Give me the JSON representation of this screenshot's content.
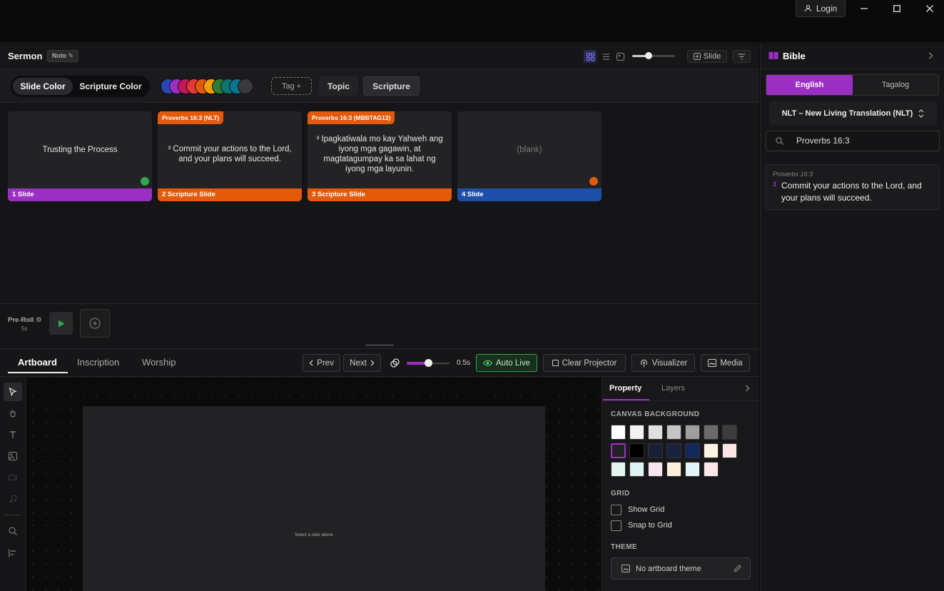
{
  "window": {
    "login_label": "Login"
  },
  "header": {
    "title": "Sermon",
    "note_badge": "Note ✎",
    "slide_button": "Slide"
  },
  "toolbar": {
    "slide_color": "Slide Color",
    "scripture_color": "Scripture Color",
    "tag_button": "Tag +",
    "topic_button": "Topic",
    "scripture_button": "Scripture",
    "swatches": [
      "#2946b8",
      "#9b2fc4",
      "#c2185b",
      "#e53935",
      "#e35a0b",
      "#f59e0b",
      "#2e7d32",
      "#0f766e",
      "#0e7490",
      "#3a3a3e"
    ]
  },
  "slides": [
    {
      "text": "Trusting the Process",
      "footer": "1 Slide",
      "footer_color": "#9b2fc4",
      "dot_color": "#2fa84f"
    },
    {
      "tag": "Proverbs 16:3 (NLT)",
      "text": "³ Commit your actions to the Lord, and your plans will succeed.",
      "footer": "2 Scripture Slide",
      "footer_color": "#e35a0b"
    },
    {
      "tag": "Proverbs 16:3 (MBBTAG12)",
      "text": "³ Ipagkatiwala mo kay Yahweh ang iyong mga gagawin, at magtatagumpay ka sa lahat ng iyong mga layunin.",
      "footer": "3 Scripture Slide",
      "footer_color": "#e35a0b"
    },
    {
      "text": "(blank)",
      "footer": "4 Slide",
      "footer_color": "#1e4fa8",
      "dot_color": "#e35a0b"
    }
  ],
  "preroll": {
    "label": "Pre-Roll ⚙",
    "time": "5s"
  },
  "bottom": {
    "tabs": [
      "Artboard",
      "Inscription",
      "Worship"
    ],
    "prev": "Prev",
    "next": "Next",
    "transition_value": "0.5s",
    "transition_level": 0.5,
    "auto_live": "Auto Live",
    "clear_projector": "Clear Projector",
    "visualizer": "Visualizer",
    "media": "Media"
  },
  "canvas": {
    "message": "Select a slide above"
  },
  "property_panel": {
    "tab_property": "Property",
    "tab_layers": "Layers",
    "canvas_background": "CANVAS BACKGROUND",
    "bg_colors": [
      "#ffffff",
      "#f2f2f2",
      "#e0e0e0",
      "#c8c4c4",
      "#9e9e9e",
      "#6b6b6b",
      "#3c3c3c",
      "#222224",
      "#000000",
      "#1a1f36",
      "#1c2140",
      "#13285a",
      "#fdf3e3",
      "#fbe4e4",
      "#e4f4ee",
      "#e0f3f4",
      "#f6e4ef",
      "#fdeedd",
      "#e3f4f8",
      "#fbe6e8"
    ],
    "grid": "GRID",
    "show_grid": "Show Grid",
    "snap_to_grid": "Snap to Grid",
    "theme": "THEME",
    "theme_value": "No artboard theme"
  },
  "bible": {
    "title": "Bible",
    "lang_english": "English",
    "lang_tagalog": "Tagalog",
    "version": "NLT – New Living Translation (NLT)",
    "search_value": "Proverbs 16:3",
    "result_ref": "Proverbs 16:3",
    "result_num": "3",
    "result_text": "Commit your actions to the Lord, and your plans will succeed."
  }
}
